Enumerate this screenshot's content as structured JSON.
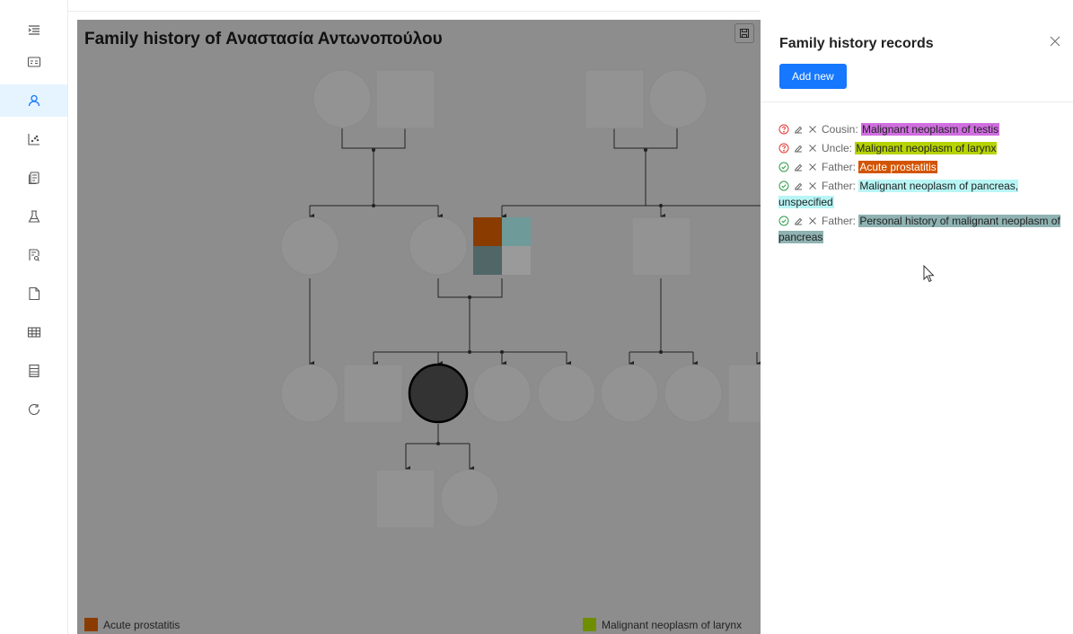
{
  "sidebar": {
    "items": [
      {
        "name": "menu-collapse-icon",
        "active": false
      },
      {
        "name": "id-card-icon",
        "active": false
      },
      {
        "name": "user-icon",
        "active": true
      },
      {
        "name": "dot-chart-icon",
        "active": false
      },
      {
        "name": "copy-docs-icon",
        "active": false
      },
      {
        "name": "flask-icon",
        "active": false
      },
      {
        "name": "file-search-icon",
        "active": false
      },
      {
        "name": "file-icon",
        "active": false
      },
      {
        "name": "table-icon",
        "active": false
      },
      {
        "name": "report-icon",
        "active": false
      },
      {
        "name": "history-icon",
        "active": false
      }
    ]
  },
  "pedigree": {
    "title": "Family history of Αναστασία Αντωνοπούλου",
    "legend": [
      {
        "label": "Acute prostatitis",
        "color": "#8a3c00"
      },
      {
        "label": "Malignant neoplasm of larynx",
        "color": "#6e8e00"
      }
    ]
  },
  "drawer": {
    "title": "Family history records",
    "add_label": "Add new",
    "records": [
      {
        "status": "unknown",
        "relation": "Cousin:",
        "condition": "Malignant neoplasm of testis",
        "color": "#d06ee0"
      },
      {
        "status": "unknown",
        "relation": "Uncle:",
        "condition": "Malignant neoplasm of larynx",
        "color": "#b7d300"
      },
      {
        "status": "confirmed",
        "relation": "Father:",
        "condition": "Acute prostatitis",
        "color": "#d35400",
        "text_color": "#ffffff"
      },
      {
        "status": "confirmed",
        "relation": "Father:",
        "condition": "Malignant neoplasm of pancreas, unspecified",
        "color": "#b8f5f5"
      },
      {
        "status": "confirmed",
        "relation": "Father:",
        "condition": "Personal history of malignant neoplasm of pancreas",
        "color": "#8fb2b2"
      }
    ]
  },
  "colors": {
    "accent": "#1677ff",
    "unknown_status": "#e53935",
    "confirmed_status": "#2e9d4a",
    "overlay": "#8d8d8d"
  }
}
